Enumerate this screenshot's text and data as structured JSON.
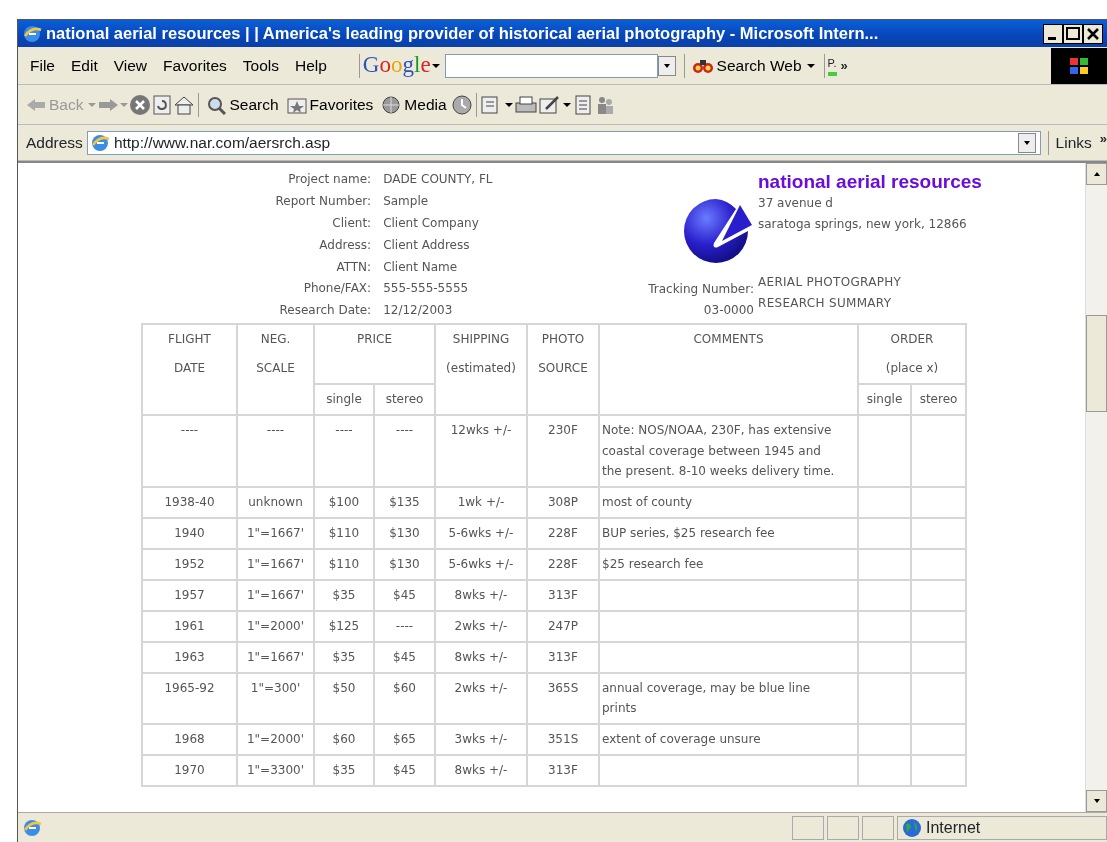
{
  "window": {
    "title": "national aerial resources | | America's leading provider of historical aerial photography - Microsoft Intern..."
  },
  "menu": [
    {
      "label": "File"
    },
    {
      "label": "Edit"
    },
    {
      "label": "View"
    },
    {
      "label": "Favorites"
    },
    {
      "label": "Tools"
    },
    {
      "label": "Help"
    }
  ],
  "google_toolbar": {
    "logo": "Google",
    "search_button": "Search Web",
    "page_rank": "P.",
    "more": "»"
  },
  "toolbar": {
    "back": "Back",
    "search": "Search",
    "favorites": "Favorites",
    "media": "Media",
    "back_disabled": true
  },
  "address_bar": {
    "label": "Address",
    "url": "http://www.nar.com/aersrch.asp",
    "links": "Links",
    "links_more": "»"
  },
  "report": {
    "fields": [
      {
        "label": "Project name:",
        "value": "DADE COUNTY, FL"
      },
      {
        "label": "Report Number:",
        "value": "Sample"
      },
      {
        "label": "Client:",
        "value": "Client Company"
      },
      {
        "label": "Address:",
        "value": "Client Address"
      },
      {
        "label": "ATTN:",
        "value": "Client Name"
      },
      {
        "label": "Phone/FAX:",
        "value": "555-555-5555"
      },
      {
        "label": "Research Date:",
        "value": "12/12/2003"
      }
    ],
    "brand": "national aerial resources",
    "brand_address": [
      "37 avenue d",
      "saratoga springs, new york, 12866"
    ],
    "tracking_label": "Tracking Number:",
    "tracking_number": "03-0000",
    "summary": [
      "AERIAL PHOTOGRAPHY",
      "RESEARCH SUMMARY"
    ]
  },
  "table": {
    "columns": [
      {
        "lines": [
          "FLIGHT",
          "DATE"
        ]
      },
      {
        "lines": [
          "NEG.",
          "SCALE"
        ]
      },
      {
        "grouped": true,
        "lines": [
          "single"
        ]
      },
      {
        "grouped": true,
        "lines": [
          "stereo"
        ]
      },
      {
        "lines": [
          "SHIPPING",
          "(estimated)"
        ]
      },
      {
        "lines": [
          "PHOTO",
          "SOURCE"
        ]
      },
      {
        "lines": [
          "COMMENTS"
        ]
      },
      {
        "grouped": true,
        "lines": [
          "single"
        ]
      },
      {
        "grouped": true,
        "lines": [
          "stereo"
        ]
      }
    ],
    "column_groups": [
      {
        "lines": [
          "PRICE"
        ]
      },
      {
        "lines": [
          "ORDER",
          "(place x)"
        ]
      }
    ],
    "rows": [
      [
        "----",
        "----",
        "----",
        "----",
        "12wks +/-",
        "230F",
        "Note: NOS/NOAA, 230F, has extensive coastal coverage between 1945 and the present. 8-10 weeks delivery time."
      ],
      [
        "1938-40",
        "unknown",
        "$100",
        "$135",
        "1wk +/-",
        "308P",
        "most of county"
      ],
      [
        "1940",
        "1\"=1667'",
        "$110",
        "$130",
        "5-6wks +/-",
        "228F",
        "BUP series, $25 research fee"
      ],
      [
        "1952",
        "1\"=1667'",
        "$110",
        "$130",
        "5-6wks +/-",
        "228F",
        "$25 research fee"
      ],
      [
        "1957",
        "1\"=1667'",
        "$35",
        "$45",
        "8wks +/-",
        "313F"
      ],
      [
        "1961",
        "1\"=2000'",
        "$125",
        "----",
        "2wks +/-",
        "247P"
      ],
      [
        "1963",
        "1\"=1667'",
        "$35",
        "$45",
        "8wks +/-",
        "313F"
      ],
      [
        "1965-92",
        "1\"=300'",
        "$50",
        "$60",
        "2wks +/-",
        "365S",
        "annual coverage, may be blue line prints"
      ],
      [
        "1968",
        "1\"=2000'",
        "$60",
        "$65",
        "3wks +/-",
        "351S",
        "extent of coverage unsure"
      ],
      [
        "1970",
        "1\"=3300'",
        "$35",
        "$45",
        "8wks +/-",
        "313F"
      ]
    ]
  },
  "status_bar": {
    "zone": "Internet"
  }
}
